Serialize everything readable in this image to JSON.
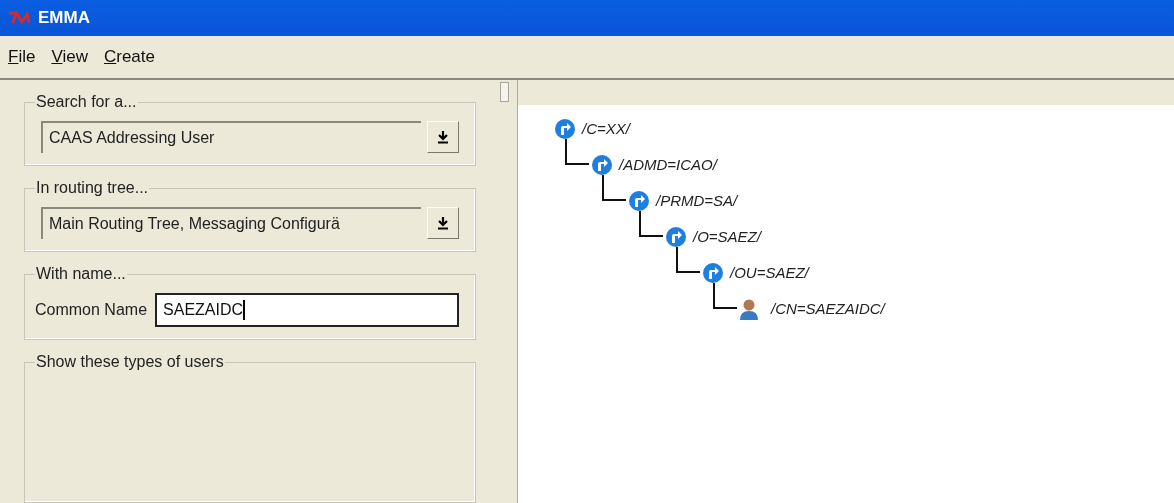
{
  "window": {
    "title": "EMMA"
  },
  "menu": [
    {
      "label": "File"
    },
    {
      "label": "View"
    },
    {
      "label": "Create"
    }
  ],
  "search_panel": {
    "groups": [
      {
        "kind": "dropdown",
        "title": "Search for a...",
        "value": "CAAS Addressing User"
      },
      {
        "kind": "dropdown",
        "title": "In routing tree...",
        "value": "Main Routing Tree, Messaging Configurä"
      },
      {
        "kind": "text",
        "title": "With name...",
        "label": "Common Name",
        "value": "SAEZAIDC",
        "focused": true
      },
      {
        "kind": "empty",
        "title": "Show these types of users"
      }
    ]
  },
  "tree": [
    {
      "kind": "route",
      "label": "/C=XX/",
      "children": [
        {
          "kind": "route",
          "label": "/ADMD=ICAO/",
          "children": [
            {
              "kind": "route",
              "label": "/PRMD=SA/",
              "children": [
                {
                  "kind": "route",
                  "label": "/O=SAEZ/",
                  "children": [
                    {
                      "kind": "route",
                      "label": "/OU=SAEZ/",
                      "children": [
                        {
                          "kind": "user",
                          "label": "/CN=SAEZAIDC/"
                        }
                      ]
                    }
                  ]
                }
              ]
            }
          ]
        }
      ]
    }
  ]
}
